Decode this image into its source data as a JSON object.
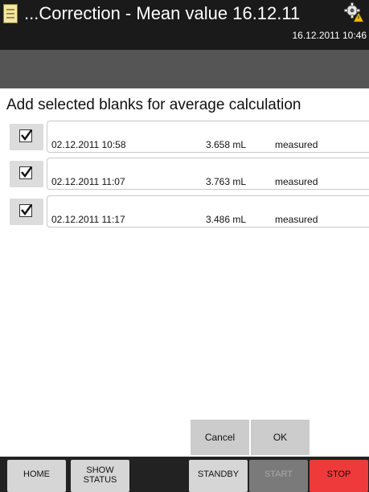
{
  "header": {
    "title": "...Correction - Mean value 16.12.11",
    "datetime": "16.12.2011 10:46",
    "left_icon": "document-icon",
    "right_icon": "gear-warning-icon"
  },
  "instruction": "Add selected blanks for average calculation",
  "blanks": [
    {
      "date": "02.12.2011 10:58",
      "volume": "3.658 mL",
      "status": "measured",
      "checked": true
    },
    {
      "date": "02.12.2011 11:07",
      "volume": "3.763 mL",
      "status": "measured",
      "checked": true
    },
    {
      "date": "02.12.2011 11:17",
      "volume": "3.486 mL",
      "status": "measured",
      "checked": true
    }
  ],
  "dialog": {
    "cancel": "Cancel",
    "ok": "OK"
  },
  "nav": {
    "home": "HOME",
    "show_status_line1": "SHOW",
    "show_status_line2": "STATUS",
    "standby": "STANDBY",
    "start": "START",
    "stop": "STOP"
  },
  "colors": {
    "header_bg": "#1a1a1a",
    "subbar_bg": "#555555",
    "stop_bg": "#ee3a3a",
    "button_bg": "#cccccc"
  }
}
